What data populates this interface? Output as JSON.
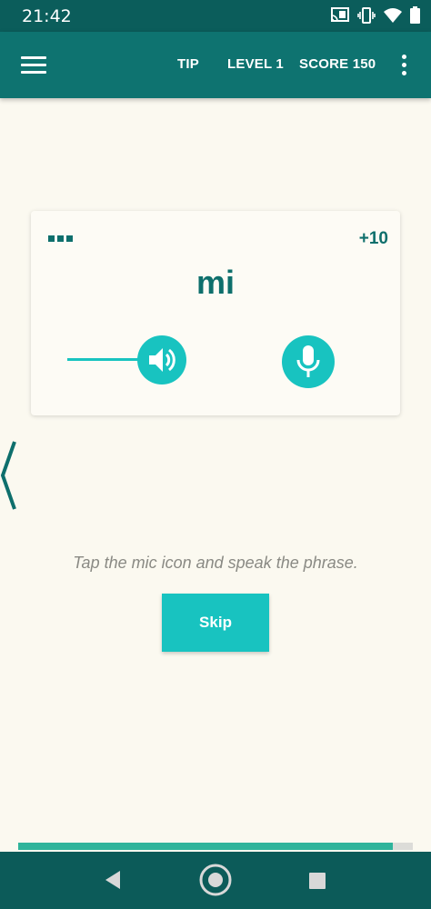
{
  "status_bar": {
    "time": "21:42",
    "icons": [
      "cast-icon",
      "vibrate-icon",
      "wifi-icon",
      "battery-icon"
    ]
  },
  "app_bar": {
    "menu_icon": "hamburger-menu-icon",
    "tip_label": "TIP",
    "level_label": "LEVEL 1",
    "score_label": "SCORE 150",
    "more_icon": "more-vertical-icon"
  },
  "card": {
    "points": "+10",
    "word": "mi",
    "speaker_icon": "speaker-icon",
    "mic_icon": "microphone-icon"
  },
  "instruction": "Tap the mic icon and speak the phrase.",
  "skip_label": "Skip",
  "progress": {
    "value": 0.95
  },
  "colors": {
    "status_bar": "#0b5d5b",
    "app_bar": "#0e7370",
    "accent": "#18c3c0",
    "text_primary": "#0e6f6c",
    "background": "#fbf9f0",
    "progress_fill": "#2fb49b",
    "nav_bar": "#0c5b59"
  },
  "nav_bar": {
    "icons": [
      "back-triangle-icon",
      "home-circle-icon",
      "recents-square-icon"
    ]
  }
}
